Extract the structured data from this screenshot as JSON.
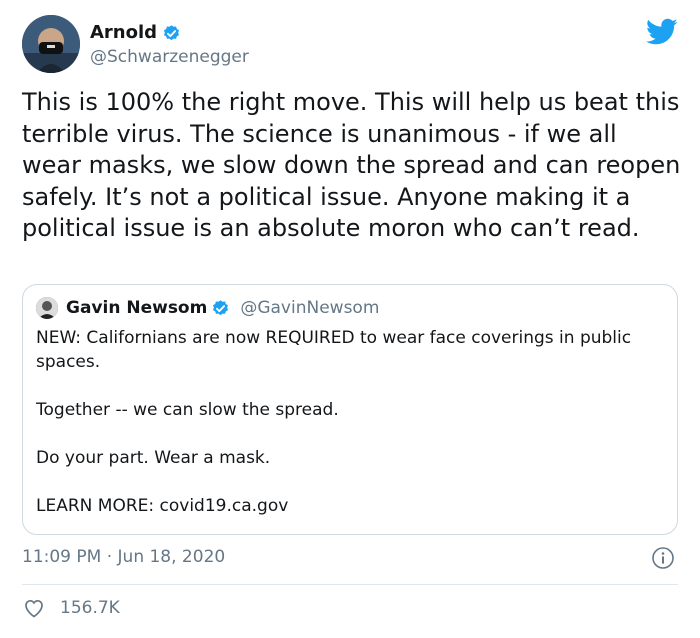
{
  "author": {
    "name": "Arnold",
    "handle": "@Schwarzenegger",
    "verified_icon": "verified-badge-icon"
  },
  "tweet": {
    "text": "This is 100% the right move. This will help us beat this terrible virus. The science is unanimous - if we all wear masks, we slow down the spread and can reopen safely. It’s not a political issue. Anyone making it a political issue is an absolute moron who can’t read."
  },
  "quote": {
    "name": "Gavin Newsom",
    "handle": "@GavinNewsom",
    "paragraphs": [
      "NEW: Californians are now REQUIRED to wear face coverings in public spaces.",
      "Together -- we can slow the spread.",
      "Do your part. Wear a mask.",
      "LEARN MORE: covid19.ca.gov"
    ]
  },
  "meta": {
    "timestamp": "11:09 PM · Jun 18, 2020",
    "likes": "156.7K"
  },
  "colors": {
    "brand": "#1da1f2",
    "secondary_text": "#657786",
    "border": "#cfd9de"
  }
}
